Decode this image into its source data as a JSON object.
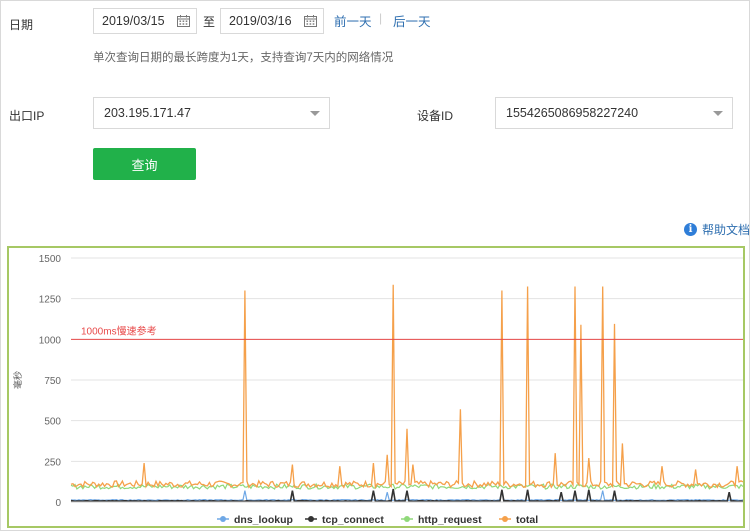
{
  "date": {
    "label": "日期",
    "start": "2019/03/15",
    "to": "至",
    "end": "2019/03/16",
    "prev": "前一天",
    "sep": "|",
    "next": "后一天",
    "hint": "单次查询日期的最长跨度为1天，支持查询7天内的网络情况"
  },
  "exit_ip": {
    "label": "出口IP",
    "value": "203.195.171.47"
  },
  "device": {
    "label": "设备ID",
    "value": "1554265086958227240"
  },
  "query_button": "查询",
  "help_link": "帮助文档",
  "colors": {
    "accent": "#21b14a",
    "link": "#2f6fb0",
    "border": "#a6c864"
  },
  "chart_data": {
    "type": "line",
    "ylabel": "毫秒",
    "ylim": [
      0,
      1500
    ],
    "yticks": [
      "1500",
      "1250",
      "1000",
      "750",
      "500",
      "250",
      "0"
    ],
    "threshold": {
      "value": 1000,
      "label": "1000ms慢速参考",
      "color": "#e84a4a"
    },
    "legend": [
      {
        "name": "dns_lookup",
        "color": "#6fa8e6"
      },
      {
        "name": "tcp_connect",
        "color": "#333333"
      },
      {
        "name": "http_request",
        "color": "#90d97a"
      },
      {
        "name": "total",
        "color": "#f5a04a"
      }
    ],
    "total_baseline": 110,
    "total_spikes": [
      {
        "x": 0.11,
        "value": 240
      },
      {
        "x": 0.26,
        "value": 1300
      },
      {
        "x": 0.33,
        "value": 230
      },
      {
        "x": 0.4,
        "value": 220
      },
      {
        "x": 0.45,
        "value": 240
      },
      {
        "x": 0.47,
        "value": 290
      },
      {
        "x": 0.48,
        "value": 1335
      },
      {
        "x": 0.5,
        "value": 450
      },
      {
        "x": 0.51,
        "value": 230
      },
      {
        "x": 0.58,
        "value": 570
      },
      {
        "x": 0.64,
        "value": 1300
      },
      {
        "x": 0.68,
        "value": 1325
      },
      {
        "x": 0.72,
        "value": 300
      },
      {
        "x": 0.75,
        "value": 1325
      },
      {
        "x": 0.76,
        "value": 1090
      },
      {
        "x": 0.77,
        "value": 270
      },
      {
        "x": 0.79,
        "value": 1325
      },
      {
        "x": 0.81,
        "value": 1095
      },
      {
        "x": 0.82,
        "value": 360
      },
      {
        "x": 0.88,
        "value": 220
      },
      {
        "x": 0.93,
        "value": 200
      },
      {
        "x": 0.99,
        "value": 220
      }
    ],
    "tcp_spikes": [
      {
        "x": 0.33,
        "value": 70
      },
      {
        "x": 0.45,
        "value": 70
      },
      {
        "x": 0.48,
        "value": 80
      },
      {
        "x": 0.5,
        "value": 70
      },
      {
        "x": 0.64,
        "value": 75
      },
      {
        "x": 0.68,
        "value": 75
      },
      {
        "x": 0.73,
        "value": 60
      },
      {
        "x": 0.75,
        "value": 70
      },
      {
        "x": 0.77,
        "value": 75
      },
      {
        "x": 0.81,
        "value": 70
      },
      {
        "x": 0.98,
        "value": 60
      }
    ],
    "dns_spikes": [
      {
        "x": 0.26,
        "value": 70
      },
      {
        "x": 0.47,
        "value": 60
      },
      {
        "x": 0.64,
        "value": 70
      },
      {
        "x": 0.79,
        "value": 70
      }
    ]
  }
}
